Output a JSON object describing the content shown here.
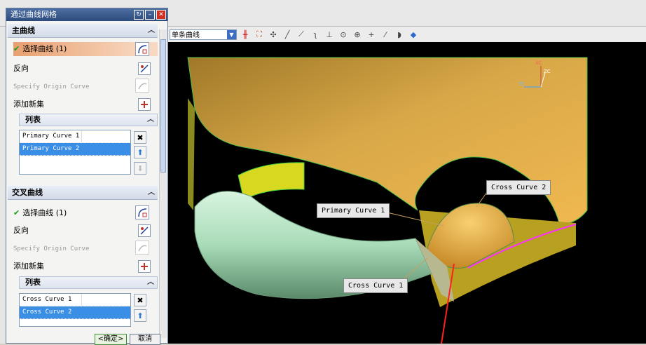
{
  "dialog": {
    "title": "通过曲线网格",
    "primary": {
      "header": "主曲线",
      "select_curve": "选择曲线 (1)",
      "reverse": "反向",
      "origin": "Specify Origin Curve",
      "add_new_set": "添加新集",
      "list_header": "列表",
      "items": [
        "Primary Curve  1",
        "Primary Curve  2"
      ]
    },
    "cross": {
      "header": "交叉曲线",
      "select_curve": "选择曲线 (1)",
      "reverse": "反向",
      "origin": "Specify Origin Curve",
      "add_new_set": "添加新集",
      "list_header": "列表",
      "items": [
        "Cross Curve  1",
        "Cross Curve  2"
      ]
    },
    "ok": "<确定>",
    "cancel": "取消"
  },
  "toolbar": {
    "curve_filter": "单条曲线"
  },
  "viewport": {
    "labels": {
      "primary_curve_1": "Primary Curve  1",
      "cross_curve_2": "Cross Curve  2",
      "cross_curve_1": "Cross Curve  1"
    },
    "axes": {
      "xc": "XC",
      "yc": "YC",
      "zc": "ZC"
    }
  },
  "colors": {
    "surface": "#c89a38",
    "tube": "#b8e8c8",
    "selection": "#3a8ee6",
    "highlight_row": "#e8a070"
  },
  "icons": [
    "refresh-icon",
    "minimize-icon",
    "close-icon",
    "select-curve-icon",
    "reverse-icon",
    "origin-curve-icon",
    "add-set-icon",
    "delete-icon",
    "move-up-icon",
    "move-down-icon"
  ]
}
